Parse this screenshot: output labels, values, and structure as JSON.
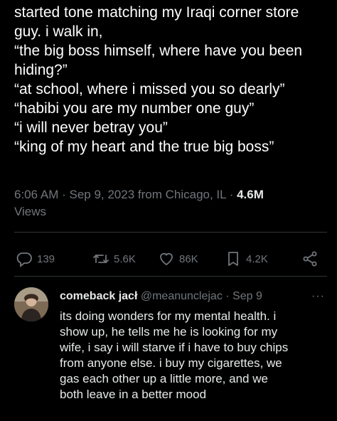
{
  "tweet": {
    "lines": [
      "started tone matching my Iraqi corner store",
      "guy. i walk in,",
      "“the big boss himself, where have you been",
      "hiding?”",
      "“at school, where i missed you so dearly”",
      "“habibi you are my number one guy”",
      "“i will never betray you”",
      "“king of my heart and the true big boss”"
    ],
    "timestamp": "6:06 AM · Sep 9, 2023 from Chicago, IL · ",
    "views_count": "4.6M",
    "views_label": "Views"
  },
  "actions": {
    "replies": "139",
    "retweets": "5.6K",
    "likes": "86K",
    "bookmarks": "4.2K"
  },
  "reply": {
    "name": "comeback jacł",
    "handle": "@meanunclejac",
    "date": " · Sep 9",
    "more": "···",
    "lines": [
      "its doing wonders for my mental health. i",
      "show up, he tells me he is looking for my",
      "wife, i say i will starve if i have to buy chips",
      "from anyone else. i buy my cigarettes, we",
      "gas each other up a little more, and we",
      "both leave in a better mood"
    ]
  },
  "colors": {
    "background": "#000000",
    "text": "#e7e9ea",
    "secondary": "#71767b",
    "divider": "#2f3336"
  },
  "icons": [
    "reply-icon",
    "retweet-icon",
    "like-icon",
    "bookmark-icon",
    "share-icon",
    "more-icon"
  ]
}
